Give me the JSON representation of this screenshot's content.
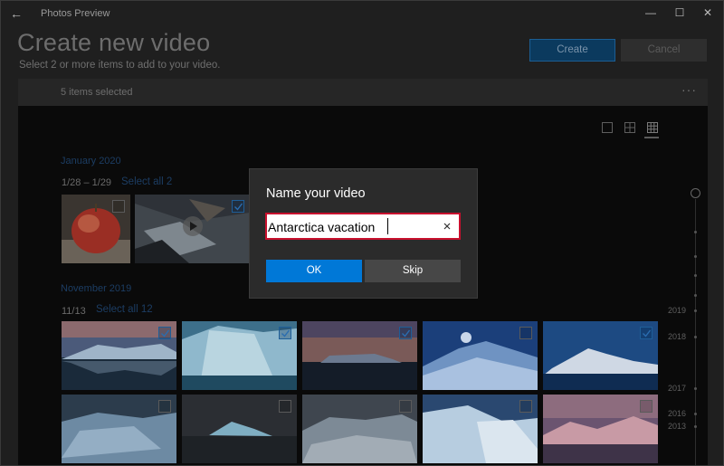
{
  "window": {
    "title": "Photos Preview",
    "back_icon": "back-arrow-icon",
    "controls": [
      "minimize-icon",
      "maximize-icon",
      "close-icon"
    ]
  },
  "header": {
    "title": "Create new video",
    "subtitle": "Select 2 or more items to add to your video.",
    "create_label": "Create",
    "cancel_label": "Cancel"
  },
  "selection_bar": {
    "count_text": "5 items selected",
    "more_icon": "more-options-icon"
  },
  "view_modes": [
    "single-view-icon",
    "medium-grid-icon",
    "small-grid-icon"
  ],
  "groups": [
    {
      "month": "January 2020",
      "range": "1/28 – 1/29",
      "select_all": "Select all 2",
      "items": [
        {
          "subject": "apple",
          "selected": false,
          "video": false
        },
        {
          "subject": "stream",
          "selected": true,
          "video": true
        }
      ]
    },
    {
      "month": "November 2019",
      "range": "11/13",
      "select_all": "Select all 12",
      "items": [
        {
          "subject": "iceberg-reflection",
          "selected": true
        },
        {
          "subject": "ice-close-up",
          "selected": true
        },
        {
          "subject": "sunset-iceberg",
          "selected": true
        },
        {
          "subject": "snow-field",
          "selected": false
        },
        {
          "subject": "snowy-mountain",
          "selected": true
        },
        {
          "subject": "blue-iceberg",
          "selected": false
        },
        {
          "subject": "distant-iceberg",
          "selected": false
        },
        {
          "subject": "ice-floe",
          "selected": false
        },
        {
          "subject": "ice-wall",
          "selected": false
        },
        {
          "subject": "pink-peaks",
          "selected": false
        }
      ]
    }
  ],
  "timeline": {
    "years": [
      "2019",
      "2018",
      "2017",
      "2016",
      "2013"
    ]
  },
  "dialog": {
    "title": "Name your video",
    "input_value": "Antarctica vacation",
    "clear_icon": "clear-icon",
    "ok_label": "OK",
    "skip_label": "Skip"
  },
  "colors": {
    "accent": "#0078d7",
    "input_focus_border": "#c8102e",
    "selection_outline": "#0b3860"
  }
}
